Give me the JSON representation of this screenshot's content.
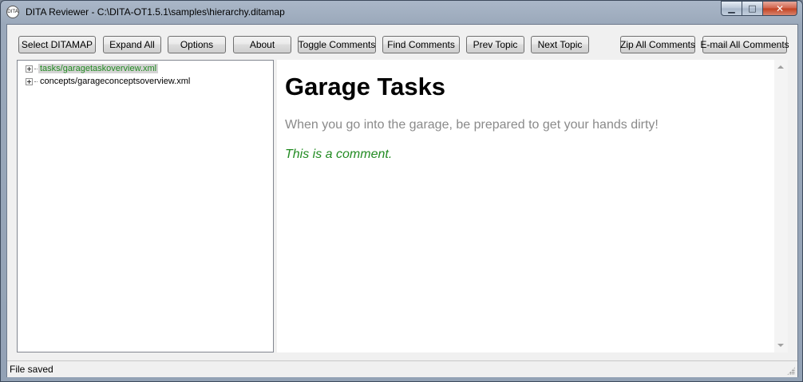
{
  "window": {
    "title": "DITA Reviewer - C:\\DITA-OT1.5.1\\samples\\hierarchy.ditamap",
    "icon": "dita-app-icon",
    "icon_text": "DITA",
    "controls": {
      "minimize": "▁",
      "maximize": "□",
      "close": "✕"
    }
  },
  "toolbar": {
    "select_ditamap": "Select DITAMAP",
    "expand_all": "Expand All",
    "options": "Options",
    "about": "About",
    "toggle_comments": "Toggle Comments",
    "find_comments": "Find Comments",
    "prev_topic": "Prev Topic",
    "next_topic": "Next Topic",
    "zip_all_comments": "Zip All Comments",
    "email_all_comments": "E-mail All Comments"
  },
  "tree": {
    "items": [
      {
        "label": "tasks/garagetaskoverview.xml",
        "selected": true
      },
      {
        "label": "concepts/garageconceptsoverview.xml",
        "selected": false
      }
    ]
  },
  "topic": {
    "title": "Garage Tasks",
    "shortdesc": "When you go into the garage, be prepared to get your hands dirty!",
    "comment": "This is a comment."
  },
  "status": {
    "text": "File saved"
  },
  "colors": {
    "comment": "#228b22",
    "shortdesc": "#8a8a8a",
    "selection_bg": "#d4d4d4"
  }
}
